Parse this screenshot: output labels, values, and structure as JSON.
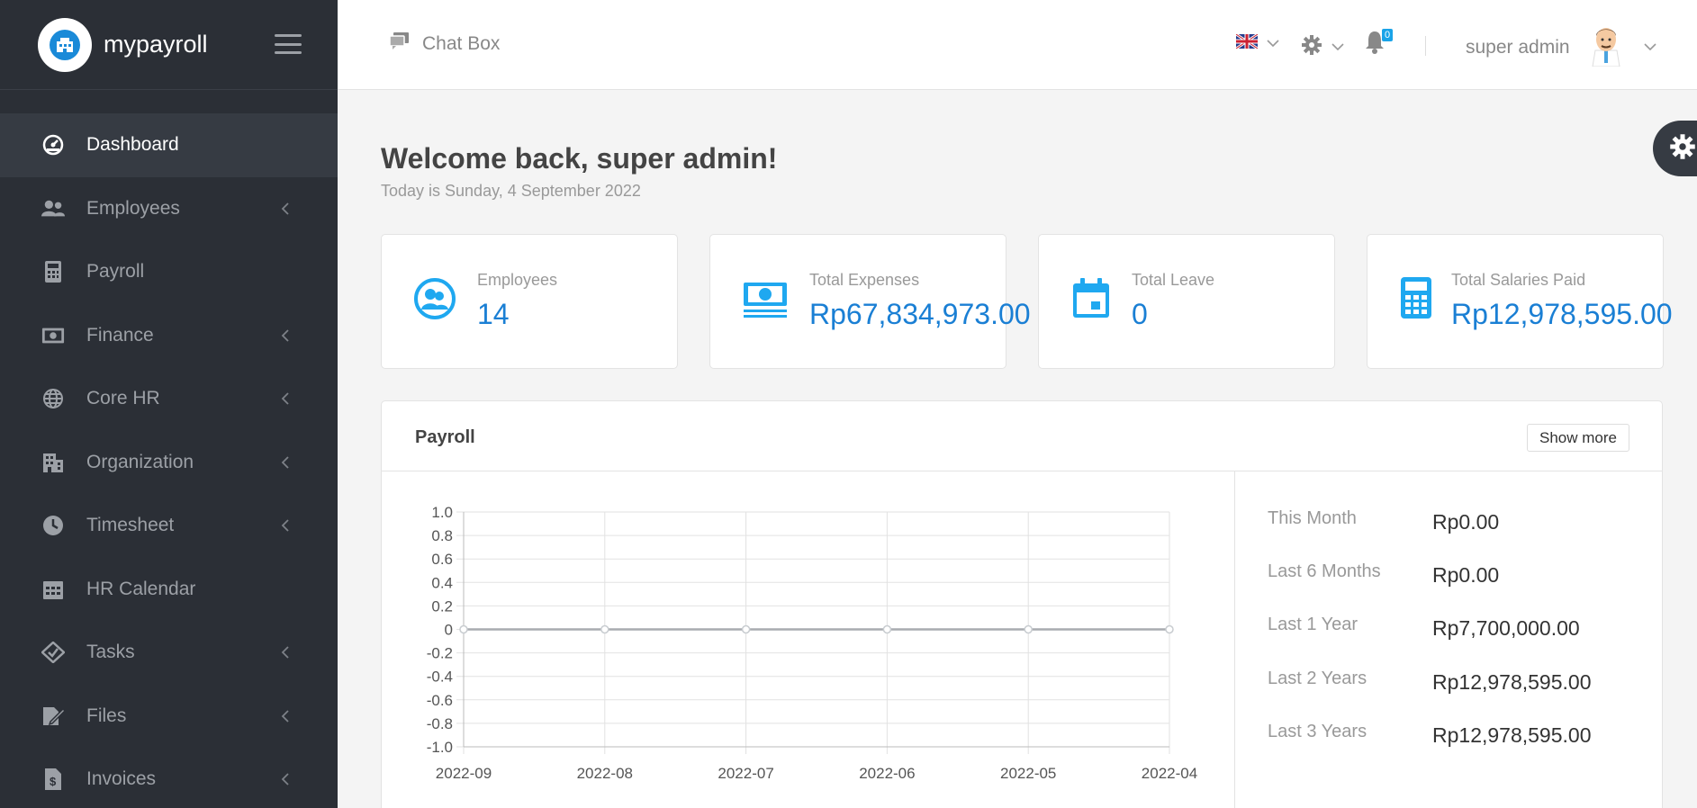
{
  "app": {
    "name": "mypayroll"
  },
  "sidebar": {
    "items": [
      {
        "label": "Dashboard",
        "icon": "dashboard-icon",
        "has_submenu": false,
        "active": true
      },
      {
        "label": "Employees",
        "icon": "users-icon",
        "has_submenu": true
      },
      {
        "label": "Payroll",
        "icon": "calculator-icon",
        "has_submenu": false
      },
      {
        "label": "Finance",
        "icon": "money-icon",
        "has_submenu": true
      },
      {
        "label": "Core HR",
        "icon": "globe-icon",
        "has_submenu": true
      },
      {
        "label": "Organization",
        "icon": "building-icon",
        "has_submenu": true
      },
      {
        "label": "Timesheet",
        "icon": "clock-icon",
        "has_submenu": true
      },
      {
        "label": "HR Calendar",
        "icon": "calendar-icon",
        "has_submenu": false
      },
      {
        "label": "Tasks",
        "icon": "tasks-icon",
        "has_submenu": true
      },
      {
        "label": "Files",
        "icon": "files-icon",
        "has_submenu": true
      },
      {
        "label": "Invoices",
        "icon": "invoice-icon",
        "has_submenu": true
      }
    ]
  },
  "header": {
    "chatbox_label": "Chat Box",
    "notification_count": "0",
    "user_name": "super admin"
  },
  "welcome": {
    "title": "Welcome back, super admin!",
    "date_line": "Today is Sunday, 4 September 2022"
  },
  "stats": [
    {
      "label": "Employees",
      "value": "14",
      "icon": "users-circle-icon"
    },
    {
      "label": "Total Expenses",
      "value": "Rp67,834,973.00",
      "icon": "money-bill-icon"
    },
    {
      "label": "Total Leave",
      "value": "0",
      "icon": "calendar-day-icon"
    },
    {
      "label": "Total Salaries Paid",
      "value": "Rp12,978,595.00",
      "icon": "calculator-icon"
    }
  ],
  "payroll_panel": {
    "title": "Payroll",
    "show_more_label": "Show more",
    "summary": [
      {
        "label": "This Month",
        "value": "Rp0.00"
      },
      {
        "label": "Last 6 Months",
        "value": "Rp0.00"
      },
      {
        "label": "Last 1 Year",
        "value": "Rp7,700,000.00"
      },
      {
        "label": "Last 2 Years",
        "value": "Rp12,978,595.00"
      },
      {
        "label": "Last 3 Years",
        "value": "Rp12,978,595.00"
      }
    ]
  },
  "colors": {
    "sidebar_bg": "#2b2f36",
    "accent": "#1a7fd4",
    "icon_blue": "#1fa8f0"
  },
  "chart_data": {
    "type": "line",
    "categories": [
      "2022-09",
      "2022-08",
      "2022-07",
      "2022-06",
      "2022-05",
      "2022-04"
    ],
    "series": [
      {
        "values": [
          0,
          0,
          0,
          0,
          0,
          0
        ]
      }
    ],
    "y_ticks": [
      "1.0",
      "0.8",
      "0.6",
      "0.4",
      "0.2",
      "0",
      "-0.2",
      "-0.4",
      "-0.6",
      "-0.8",
      "-1.0"
    ],
    "ylim": [
      -1.0,
      1.0
    ],
    "grid": true
  }
}
